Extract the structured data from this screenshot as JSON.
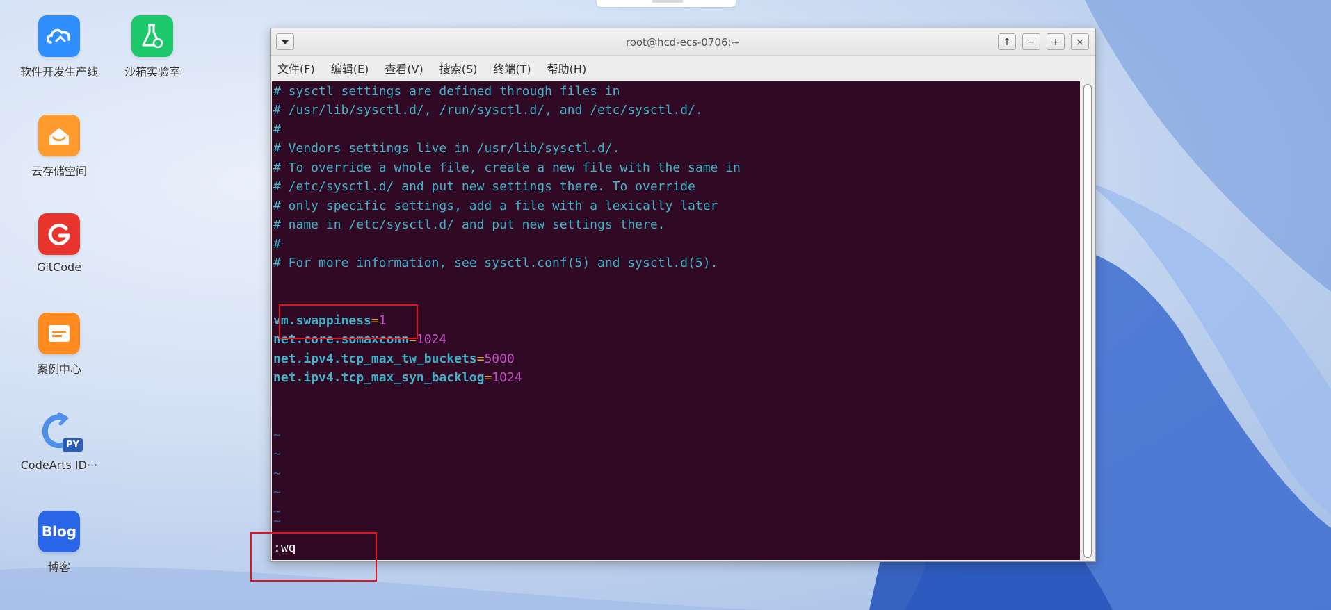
{
  "desktop": {
    "icons": [
      {
        "label": "软件开发生产线",
        "icon": "cloud-devops-icon",
        "color": "#2f8fff"
      },
      {
        "label": "沙箱实验室",
        "icon": "flask-lab-icon",
        "color": "#1dc86a"
      },
      {
        "label": "云存储空间",
        "icon": "cloud-storage-icon",
        "color": "#ff9a2e"
      },
      {
        "label": "GitCode",
        "icon": "gitcode-icon",
        "color": "#e8352e"
      },
      {
        "label": "案例中心",
        "icon": "case-center-icon",
        "color": "#ff8a1f"
      },
      {
        "label": "CodeArts ID···",
        "icon": "codearts-python-icon",
        "color": "#3b7fe0"
      },
      {
        "label": "博客",
        "icon": "blog-icon",
        "color": "#2a66e8"
      }
    ],
    "blog_tile_text": "Blog",
    "py_badge": "PY"
  },
  "window": {
    "title": "root@hcd-ecs-0706:~",
    "controls": [
      "↑",
      "−",
      "+",
      "×"
    ],
    "menu": [
      "文件(F)",
      "编辑(E)",
      "查看(V)",
      "搜索(S)",
      "终端(T)",
      "帮助(H)"
    ]
  },
  "terminal": {
    "comments": [
      "# sysctl settings are defined through files in",
      "# /usr/lib/sysctl.d/, /run/sysctl.d/, and /etc/sysctl.d/.",
      "#",
      "# Vendors settings live in /usr/lib/sysctl.d/.",
      "# To override a whole file, create a new file with the same in",
      "# /etc/sysctl.d/ and put new settings there. To override",
      "# only specific settings, add a file with a lexically later",
      "# name in /etc/sysctl.d/ and put new settings there.",
      "#",
      "# For more information, see sysctl.conf(5) and sysctl.d(5)."
    ],
    "settings": [
      {
        "key": "vm.swappiness",
        "value": "1"
      },
      {
        "key": "net.core.somaxconn",
        "value": "1024"
      },
      {
        "key": "net.ipv4.tcp_max_tw_buckets",
        "value": "5000"
      },
      {
        "key": "net.ipv4.tcp_max_syn_backlog",
        "value": "1024"
      }
    ],
    "tilde": "~",
    "command": ":wq"
  },
  "colors": {
    "terminal_bg": "#300a24",
    "comment": "#3fb2c7",
    "equals": "#d8a63a",
    "value": "#c44fc5",
    "highlight_box": "#e0141e"
  }
}
